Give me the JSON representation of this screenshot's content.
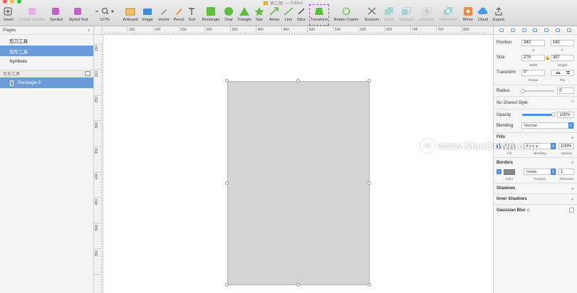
{
  "window": {
    "title": "第三期",
    "edited": "— Edited"
  },
  "toolbar": {
    "items": [
      {
        "label": "Insert",
        "icon": "plus-icon"
      },
      {
        "label": "Create Symbol",
        "icon": "create-symbol-icon"
      },
      {
        "label": "Symbol",
        "icon": "symbol-icon"
      },
      {
        "label": "Styled Text",
        "icon": "styled-text-icon"
      },
      {
        "label": "127%",
        "icon": "zoom-icon"
      },
      {
        "label": "Artboard",
        "icon": "artboard-icon"
      },
      {
        "label": "Image",
        "icon": "image-icon"
      },
      {
        "label": "Vector",
        "icon": "vector-icon"
      },
      {
        "label": "Pencil",
        "icon": "pencil-icon"
      },
      {
        "label": "Text",
        "icon": "text-icon"
      },
      {
        "label": "Rectangle",
        "icon": "rectangle-icon"
      },
      {
        "label": "Oval",
        "icon": "oval-icon"
      },
      {
        "label": "Triangle",
        "icon": "triangle-icon"
      },
      {
        "label": "Star",
        "icon": "star-icon"
      },
      {
        "label": "Arrow",
        "icon": "arrow-icon"
      },
      {
        "label": "Line",
        "icon": "line-icon"
      },
      {
        "label": "Slice",
        "icon": "slice-icon"
      },
      {
        "label": "Transform",
        "icon": "transform-icon"
      },
      {
        "label": "Rotate Copies",
        "icon": "rotate-copies-icon"
      },
      {
        "label": "Scissors",
        "icon": "scissors-icon"
      },
      {
        "label": "Union",
        "icon": "union-icon"
      },
      {
        "label": "Subtract",
        "icon": "subtract-icon"
      },
      {
        "label": "Intersect",
        "icon": "intersect-icon"
      },
      {
        "label": "Difference",
        "icon": "difference-icon"
      },
      {
        "label": "Mirror",
        "icon": "mirror-icon"
      },
      {
        "label": "Cloud",
        "icon": "cloud-icon"
      },
      {
        "label": "Export",
        "icon": "export-icon"
      }
    ]
  },
  "pages": {
    "header": "Pages",
    "add": "+",
    "items": [
      "剪刀工具",
      "变形工具",
      "Symbols"
    ],
    "selected_index": 1
  },
  "layers": {
    "header": "变形工具",
    "items": [
      "Rectangle 3"
    ]
  },
  "rulers": {
    "top": [
      "150",
      "200",
      "250",
      "300",
      "350",
      "400",
      "450",
      "500",
      "550",
      "600",
      "650",
      "700",
      "750",
      "800"
    ],
    "left": [
      "150",
      "200",
      "250",
      "300",
      "350",
      "400",
      "450",
      "500",
      "550"
    ]
  },
  "inspector": {
    "position": {
      "label": "Position",
      "x": "343",
      "y": "160",
      "x_label": "X",
      "y_label": "Y"
    },
    "size": {
      "label": "Size",
      "width": "276",
      "height": "397",
      "width_label": "Width",
      "height_label": "Height"
    },
    "transform": {
      "label": "Transform",
      "rotate": "0°",
      "rotate_label": "Rotate",
      "flip_label": "Flip"
    },
    "radius": {
      "label": "Radius",
      "value": "0"
    },
    "shared_style": "No Shared Style",
    "opacity": {
      "label": "Opacity",
      "value": "100%"
    },
    "blending": {
      "label": "Blending",
      "value": "Normal"
    },
    "fills": {
      "title": "Fills",
      "blend": "Normal",
      "opacity": "100%",
      "fill_label": "Fill",
      "blending_label": "Blending",
      "opacity_label": "Opacity",
      "color": "#d4d4d4"
    },
    "borders": {
      "title": "Borders",
      "position": "Inside",
      "thickness": "1",
      "color_label": "Color",
      "position_label": "Position",
      "thickness_label": "Thickness",
      "color": "#888888"
    },
    "shadows": "Shadows",
    "inner_shadows": "Inner Shadows",
    "gaussian_blur": "Gaussian Blur ◇"
  },
  "watermark": "www.MacDown.com",
  "colors": {
    "accent": "#6c9bd9",
    "shape_fill": "#d4d4d4",
    "transform_highlight": "#b04bd1"
  }
}
